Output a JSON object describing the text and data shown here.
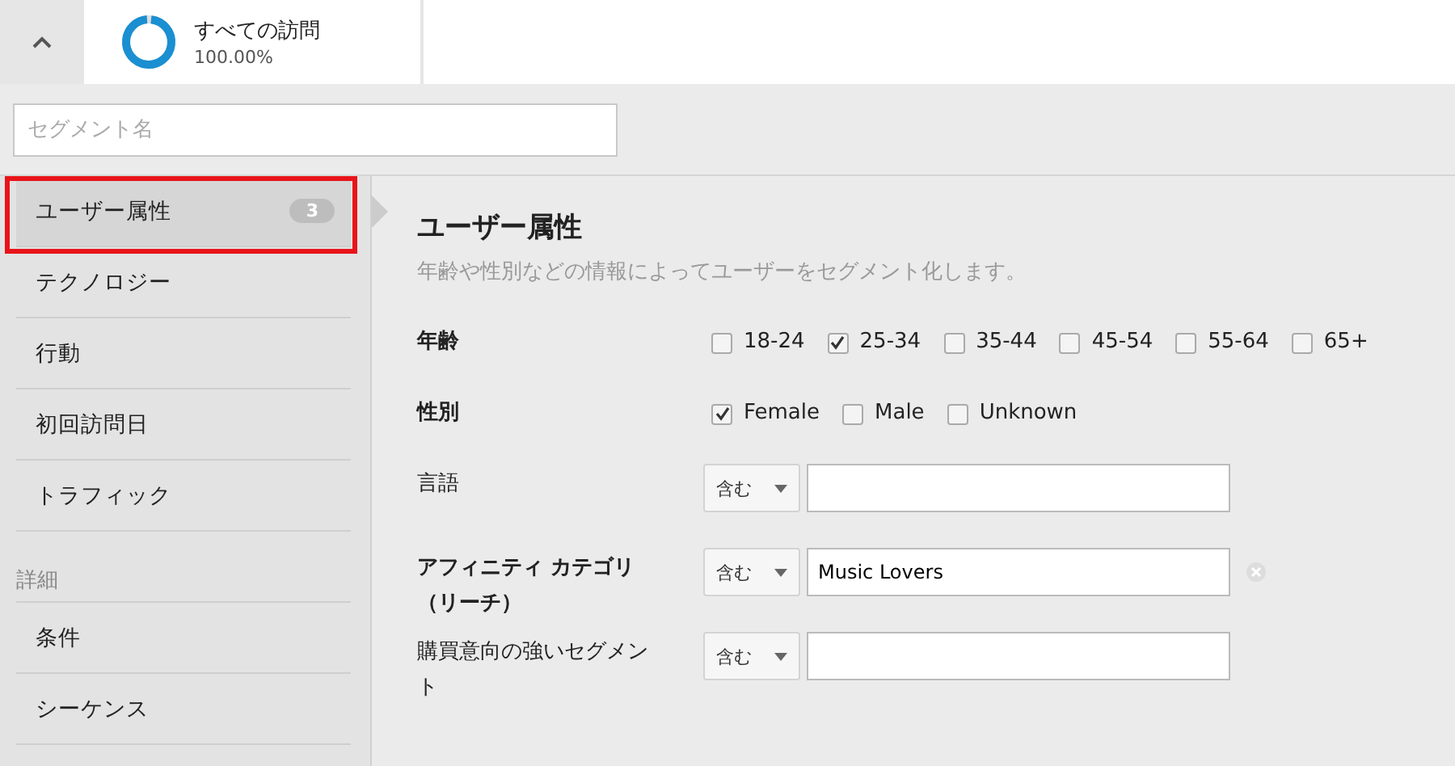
{
  "segment_summary": {
    "title": "すべての訪問",
    "percent": "100.00%",
    "level": 1
  },
  "segment_name": {
    "placeholder": "セグメント名"
  },
  "sidebar": {
    "items": [
      {
        "label": "ユーザー属性",
        "count": "3",
        "selected": true
      },
      {
        "label": "テクノロジー",
        "selected": false
      },
      {
        "label": "行動",
        "selected": false
      },
      {
        "label": "初回訪問日",
        "selected": false
      },
      {
        "label": "トラフィック",
        "selected": false
      }
    ],
    "section": "詳細",
    "advanced_items": [
      {
        "label": "条件",
        "selected": false
      },
      {
        "label": "シーケンス",
        "selected": false
      }
    ]
  },
  "panel": {
    "title": "ユーザー属性",
    "description": "年齢や性別などの情報によってユーザーをセグメント化します。",
    "rows": [
      {
        "kind": "checks",
        "label": "年齢",
        "active": true,
        "options": [
          {
            "label": "18-24",
            "checked": false
          },
          {
            "label": "25-34",
            "checked": true
          },
          {
            "label": "35-44",
            "checked": false
          },
          {
            "label": "45-54",
            "checked": false
          },
          {
            "label": "55-64",
            "checked": false
          },
          {
            "label": "65+",
            "checked": false
          }
        ]
      },
      {
        "kind": "checks",
        "label": "性別",
        "active": true,
        "options": [
          {
            "label": "Female",
            "checked": true
          },
          {
            "label": "Male",
            "checked": false
          },
          {
            "label": "Unknown",
            "checked": false
          }
        ]
      },
      {
        "kind": "text",
        "label": "言語",
        "active": false,
        "operator": "含む",
        "value": ""
      },
      {
        "kind": "text",
        "label": "アフィニティ カテゴリ（リーチ）",
        "active": true,
        "operator": "含む",
        "value": "Music Lovers"
      },
      {
        "kind": "text",
        "label": "購買意向の強いセグメント",
        "active": false,
        "operator": "含む",
        "value": ""
      }
    ]
  }
}
